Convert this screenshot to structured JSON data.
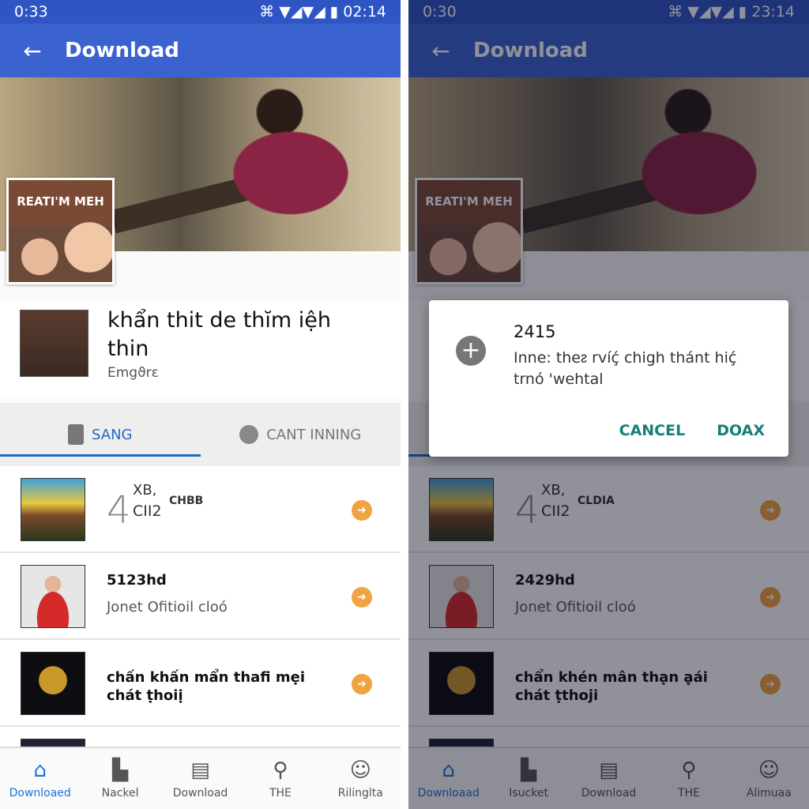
{
  "colors": {
    "statusbar": "#2f55c4",
    "appbar": "#3a63d0",
    "accent": "#1e6bc2",
    "download_icon": "#f0a341",
    "dialog_action": "#167f7a"
  },
  "left": {
    "status": {
      "time": "0:33",
      "clock": "02:14"
    },
    "appbar": {
      "back_icon": "arrow-left",
      "title": "Download"
    },
    "poster_text": "REATI'M MEH",
    "header": {
      "title": "khẩn thit de thĭm iệh thin",
      "subtitle": "Emgϑrε"
    },
    "tabs": [
      {
        "label": "SANG",
        "active": true
      },
      {
        "label": "CANT INNING",
        "active": false
      }
    ],
    "rows": [
      {
        "big": "4",
        "line1": "XB,",
        "line2": "CII2",
        "tag": "CHBB"
      },
      {
        "title": "5123hd",
        "subtitle": "Jonet Ofitioil  cloó"
      },
      {
        "title": "chấn khấn mẩn  thafi mẹi chát ṭhoiị"
      }
    ],
    "nav": [
      {
        "label": "Downloaed",
        "icon": "home",
        "active": true
      },
      {
        "label": "Nackel",
        "icon": "bag"
      },
      {
        "label": "Download",
        "icon": "document"
      },
      {
        "label": "THE",
        "icon": "search"
      },
      {
        "label": "Rilinglta",
        "icon": "person"
      }
    ]
  },
  "right": {
    "status": {
      "time": "0:30",
      "clock": "23:14"
    },
    "appbar": {
      "back_icon": "arrow-left",
      "title": "Download"
    },
    "poster_text": "REATI'M MEH",
    "rows": [
      {
        "big": "4",
        "line1": "XB,",
        "line2": "CII2",
        "tag": "CLDIA"
      },
      {
        "title": "2429hd",
        "subtitle": "Jonet Ofitioil  cloó"
      },
      {
        "title": "chẩn khén mân  thạn ḁái chát ṭthoji"
      }
    ],
    "nav": [
      {
        "label": "Downloaad",
        "icon": "home",
        "active": true
      },
      {
        "label": "Isucket",
        "icon": "bag"
      },
      {
        "label": "Download",
        "icon": "document"
      },
      {
        "label": "THE",
        "icon": "search"
      },
      {
        "label": "Alimuaa",
        "icon": "person"
      }
    ],
    "dialog": {
      "title": "2415",
      "body": "Inne꞉ theᴤ rvíḉ chigh thánt hiḉ trnó 'wehtal",
      "cancel": "CANCEL",
      "confirm": "DOAX"
    }
  }
}
